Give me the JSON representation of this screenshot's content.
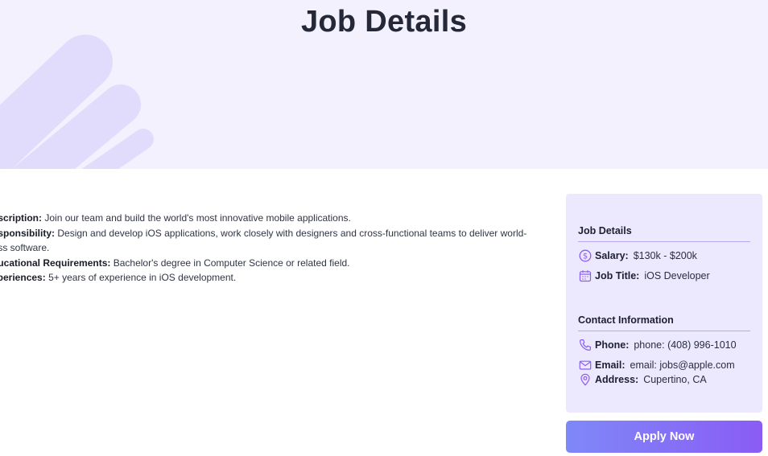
{
  "hero": {
    "title": "Job Details"
  },
  "description": {
    "items": [
      {
        "label": "Description:",
        "text": "Join our team and build the world's most innovative mobile applications."
      },
      {
        "label": "Responsibility:",
        "text": "Design and develop iOS applications, work closely with designers and cross-functional teams to deliver world-class software."
      },
      {
        "label": "Educational Requirements:",
        "text": "Bachelor's degree in Computer Science or related field."
      },
      {
        "label": "Experiences:",
        "text": "5+ years of experience in iOS development."
      }
    ]
  },
  "sidebar": {
    "job_details": {
      "title": "Job Details",
      "salary_label": "Salary:",
      "salary_value": "$130k - $200k",
      "job_title_label": "Job Title:",
      "job_title_value": "iOS Developer"
    },
    "contact": {
      "title": "Contact Information",
      "phone_label": "Phone:",
      "phone_value": "phone: (408) 996-1010",
      "email_label": "Email:",
      "email_value": "email: jobs@apple.com",
      "address_label": "Address:",
      "address_value": "Cupertino, CA"
    }
  },
  "actions": {
    "apply_label": "Apply Now"
  },
  "colors": {
    "accent": "#8b5cf6",
    "hero_bg": "#f3f1fd",
    "card_bg": "#ece8fd"
  },
  "icons": [
    "dollar-circle-icon",
    "calendar-icon",
    "phone-icon",
    "mail-icon",
    "map-pin-icon"
  ]
}
